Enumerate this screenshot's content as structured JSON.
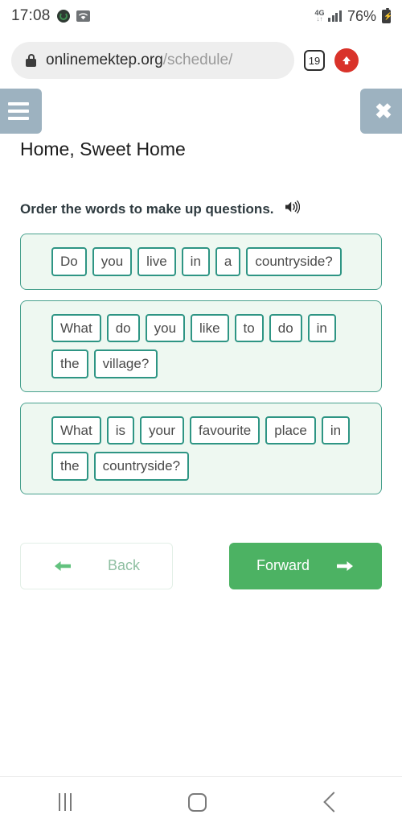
{
  "status_bar": {
    "time": "17:08",
    "network_type": "4G",
    "network_arrows": "↓↑",
    "battery_percent": "76%",
    "icons": [
      "sync-icon",
      "wifi-icon",
      "signal-bars-icon",
      "battery-icon"
    ]
  },
  "browser": {
    "url_domain": "onlinemektep.org",
    "url_path": "/schedule/",
    "tab_count": "19",
    "lock_icon": "lock-icon",
    "action_icon": "opera-upload-icon"
  },
  "app_header": {
    "menu_label": "☰",
    "close_label": "✖"
  },
  "lesson": {
    "title": "Home, Sweet Home",
    "task_instruction": "Order the words to make up questions.",
    "audio_icon": "speaker-icon"
  },
  "word_groups": [
    {
      "id": "question-1",
      "words": [
        "Do",
        "you",
        "live",
        "in",
        "a",
        "countryside?"
      ]
    },
    {
      "id": "question-2",
      "words": [
        "What",
        "do",
        "you",
        "like",
        "to",
        "do",
        "in",
        "the",
        "village?"
      ]
    },
    {
      "id": "question-3",
      "words": [
        "What",
        "is",
        "your",
        "favourite",
        "place",
        "in",
        "the",
        "countryside?"
      ]
    }
  ],
  "navigation": {
    "back_label": "Back",
    "forward_label": "Forward",
    "back_arrow_color": "#62c27e",
    "forward_bg_color": "#4cb263"
  },
  "android_nav": {
    "recents": "recents-icon",
    "home": "home-icon",
    "back": "back-icon"
  },
  "theme": {
    "card_border": "#49a18e",
    "card_bg": "#eef8f1",
    "chip_border": "#2e9584",
    "header_button_bg": "#9db2c0",
    "accent_green": "#4cb263",
    "opera_red": "#d9332a"
  }
}
